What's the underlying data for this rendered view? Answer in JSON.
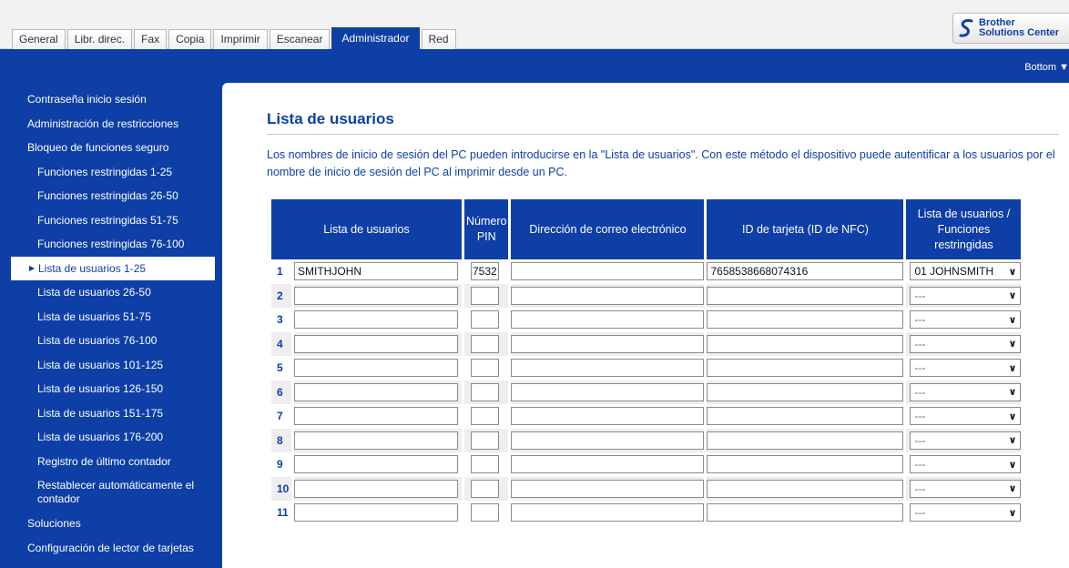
{
  "tabs": [
    "General",
    "Libr. direc.",
    "Fax",
    "Copia",
    "Imprimir",
    "Escanear",
    "Administrador",
    "Red"
  ],
  "active_tab": "Administrador",
  "brand": {
    "line1": "Brother",
    "line2": "Solutions Center",
    "color": "#0d3fa6"
  },
  "bottom_link": "Bottom ▼",
  "sidebar": [
    "Contraseña inicio sesión",
    "Administración de restricciones",
    "Bloqueo de funciones seguro",
    "Funciones restringidas 1-25",
    "Funciones restringidas 26-50",
    "Funciones restringidas 51-75",
    "Funciones restringidas 76-100",
    "Lista de usuarios 1-25",
    "Lista de usuarios 26-50",
    "Lista de usuarios 51-75",
    "Lista de usuarios 76-100",
    "Lista de usuarios 101-125",
    "Lista de usuarios 126-150",
    "Lista de usuarios 151-175",
    "Lista de usuarios 176-200",
    "Registro de último contador",
    "Restablecer automáticamente el contador",
    "Soluciones",
    "Configuración de lector de tarjetas"
  ],
  "page": {
    "title": "Lista de usuarios",
    "description": "Los nombres de inicio de sesión del PC pueden introducirse en la \"Lista de usuarios\". Con este método el dispositivo puede autentificar a los usuarios por el nombre de inicio de sesión del PC al imprimir desde un PC."
  },
  "table": {
    "headers": {
      "user": "Lista de usuarios",
      "pin": "Número PIN",
      "email": "Dirección de correo electrónico",
      "card": "ID de tarjeta (ID de NFC)",
      "func": "Lista de usuarios / Funciones restringidas"
    },
    "rows": [
      {
        "num": "1",
        "user": "SMITHJOHN",
        "pin": "7532",
        "email": "",
        "card": "7658538668074316",
        "func": "01 JOHNSMITH"
      },
      {
        "num": "2",
        "user": "",
        "pin": "",
        "email": "",
        "card": "",
        "func": "---"
      },
      {
        "num": "3",
        "user": "",
        "pin": "",
        "email": "",
        "card": "",
        "func": "---"
      },
      {
        "num": "4",
        "user": "",
        "pin": "",
        "email": "",
        "card": "",
        "func": "---"
      },
      {
        "num": "5",
        "user": "",
        "pin": "",
        "email": "",
        "card": "",
        "func": "---"
      },
      {
        "num": "6",
        "user": "",
        "pin": "",
        "email": "",
        "card": "",
        "func": "---"
      },
      {
        "num": "7",
        "user": "",
        "pin": "",
        "email": "",
        "card": "",
        "func": "---"
      },
      {
        "num": "8",
        "user": "",
        "pin": "",
        "email": "",
        "card": "",
        "func": "---"
      },
      {
        "num": "9",
        "user": "",
        "pin": "",
        "email": "",
        "card": "",
        "func": "---"
      },
      {
        "num": "10",
        "user": "",
        "pin": "",
        "email": "",
        "card": "",
        "func": "---"
      },
      {
        "num": "11",
        "user": "",
        "pin": "",
        "email": "",
        "card": "",
        "func": "---"
      }
    ]
  }
}
